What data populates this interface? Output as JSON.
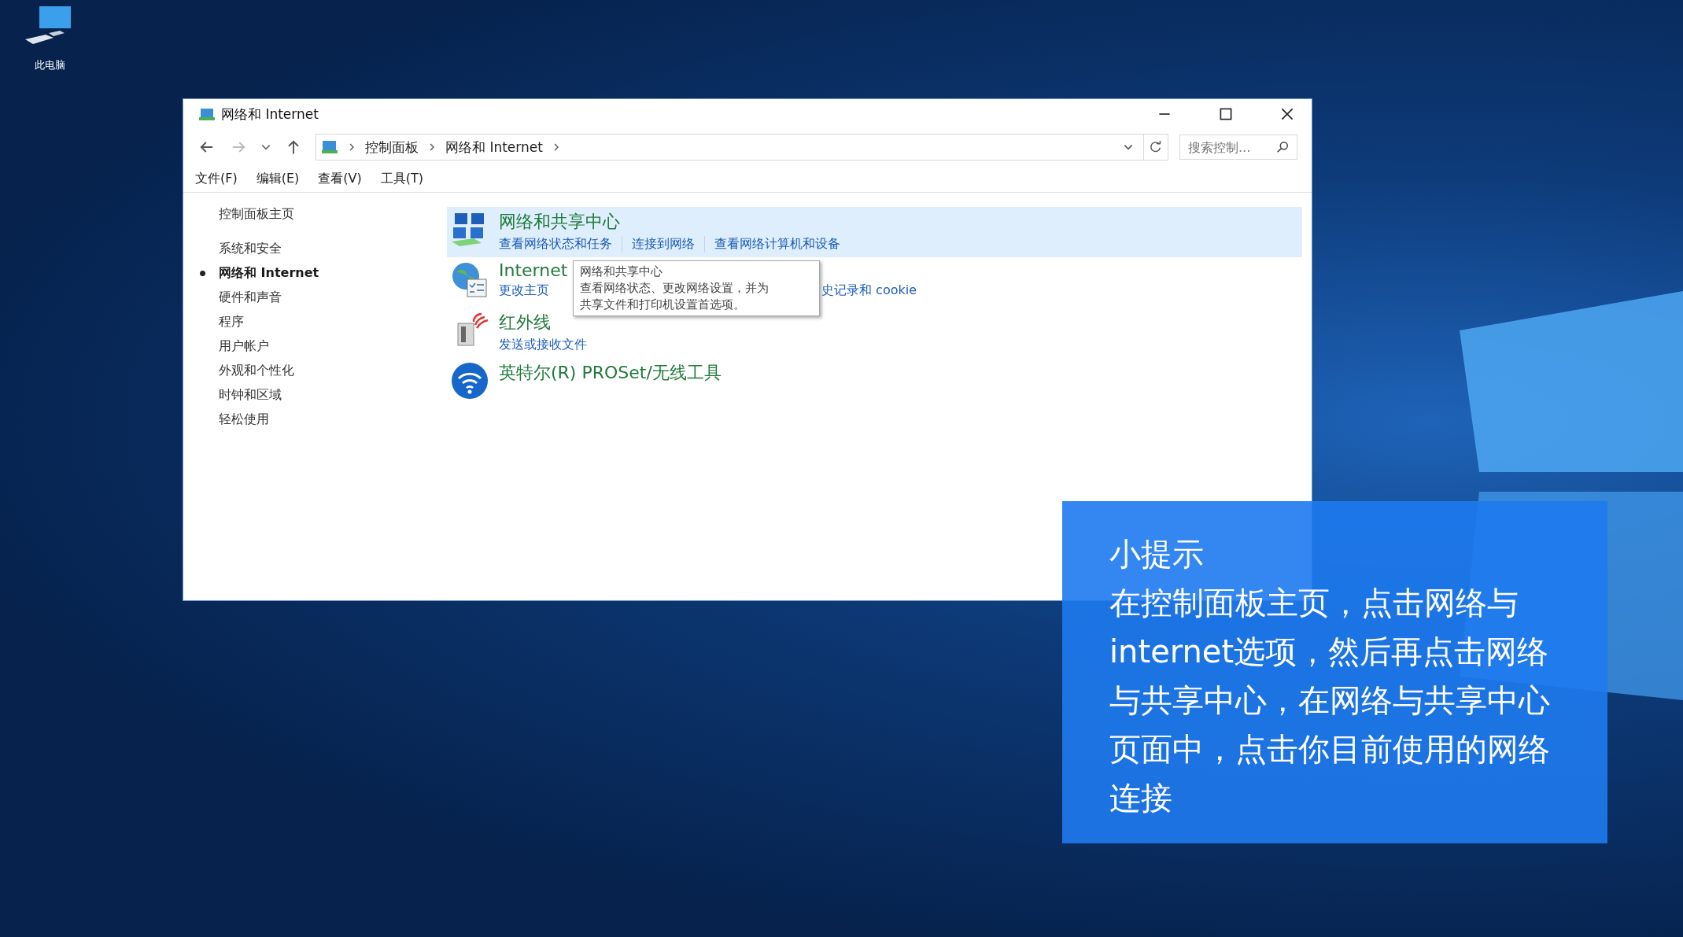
{
  "desktop": {
    "icons": [
      {
        "label": "此电脑"
      }
    ]
  },
  "window": {
    "title": "网络和 Internet",
    "breadcrumb": [
      "控制面板",
      "网络和 Internet"
    ],
    "search": {
      "placeholder": "搜索控制..."
    },
    "menu": [
      "文件(F)",
      "编辑(E)",
      "查看(V)",
      "工具(T)"
    ],
    "sidebar": {
      "items": [
        {
          "label": "控制面板主页",
          "kind": "home",
          "selected": false
        },
        {
          "label": "系统和安全",
          "kind": "category",
          "selected": false
        },
        {
          "label": "网络和 Internet",
          "kind": "category",
          "selected": true
        },
        {
          "label": "硬件和声音",
          "kind": "category",
          "selected": false
        },
        {
          "label": "程序",
          "kind": "category",
          "selected": false
        },
        {
          "label": "用户帐户",
          "kind": "category",
          "selected": false
        },
        {
          "label": "外观和个性化",
          "kind": "category",
          "selected": false
        },
        {
          "label": "时钟和区域",
          "kind": "category",
          "selected": false
        },
        {
          "label": "轻松使用",
          "kind": "category",
          "selected": false
        }
      ]
    },
    "categories": [
      {
        "title": "网络和共享中心",
        "highlighted": true,
        "links": [
          "查看网络状态和任务",
          "连接到网络",
          "查看网络计算机和设备"
        ]
      },
      {
        "title": "Internet",
        "highlighted": false,
        "links": [
          "更改主页",
          "史记录和 cookie"
        ]
      },
      {
        "title": "红外线",
        "highlighted": false,
        "links": [
          "发送或接收文件"
        ]
      },
      {
        "title": "英特尔(R) PROSet/无线工具",
        "highlighted": false
      }
    ],
    "tooltip": {
      "title": "网络和共享中心",
      "lines": [
        "查看网络状态、更改网络设置，并为",
        "共享文件和打印机设置首选项。"
      ]
    }
  },
  "tip": {
    "title": "小提示",
    "body": "在控制面板主页，点击网络与internet选项，然后再点击网络与共享中心，在网络与共享中心页面中，点击你目前使用的网络连接"
  }
}
